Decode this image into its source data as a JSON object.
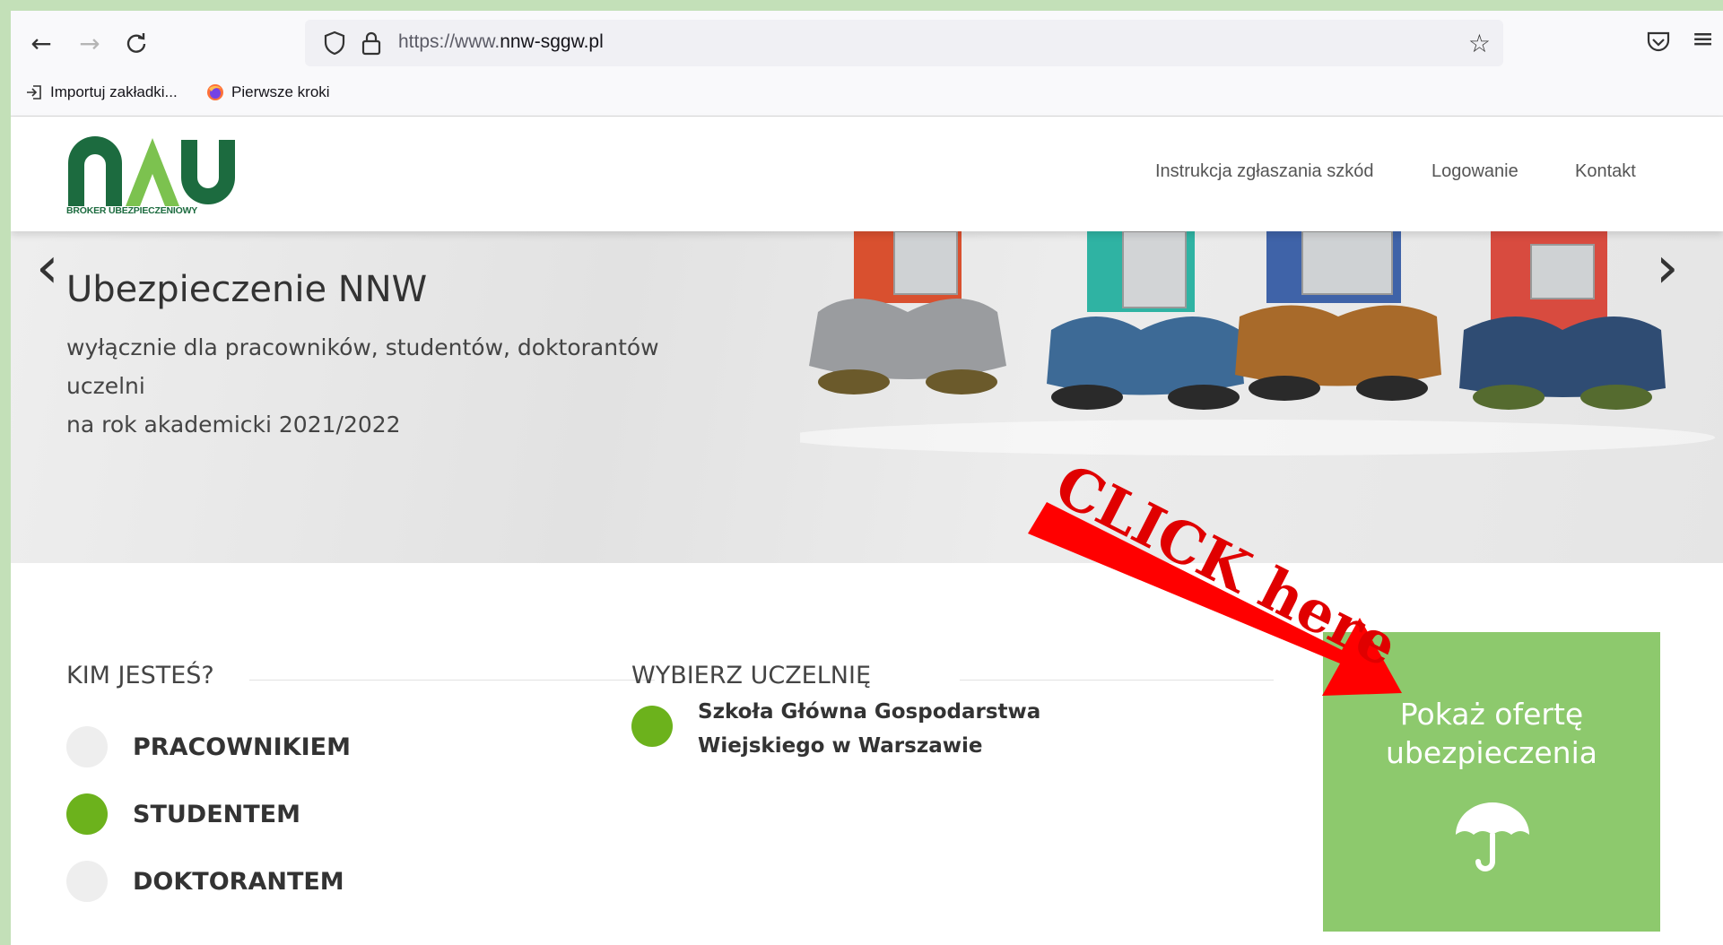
{
  "browser": {
    "url_prefix": "https://www.",
    "url_domain": "nnw-sggw.pl",
    "bookmarks": [
      {
        "label": "Importuj zakładki..."
      },
      {
        "label": "Pierwsze kroki"
      }
    ]
  },
  "header": {
    "logo_sub": "BROKER UBEZPIECZENIOWY",
    "menu": [
      {
        "label": "Instrukcja zgłaszania szkód"
      },
      {
        "label": "Logowanie"
      },
      {
        "label": "Kontakt"
      }
    ]
  },
  "hero": {
    "title": "Ubezpieczenie NNW",
    "subtitle_line1": "wyłącznie dla pracowników, studentów, doktorantów uczelni",
    "subtitle_line2": "na rok akademicki 2021/2022"
  },
  "annotation": {
    "text": "CLICK here",
    "color": "#ff0000"
  },
  "form": {
    "who_label": "KIM JESTEŚ?",
    "options": [
      {
        "label": "PRACOWNIKIEM",
        "selected": false
      },
      {
        "label": "STUDENTEM",
        "selected": true
      },
      {
        "label": "DOKTORANTEM",
        "selected": false
      }
    ],
    "university_label": "WYBIERZ UCZELNIĘ",
    "university": {
      "label": "Szkoła Główna Gospodarstwa Wiejskiego w Warszawie",
      "selected": true
    }
  },
  "offer": {
    "line1": "Pokaż ofertę",
    "line2": "ubezpieczenia",
    "icon": "umbrella-icon"
  },
  "colors": {
    "accent_green": "#6cb21c",
    "offer_green": "#8dc96d",
    "logo_green": "#1c6b3f",
    "logo_light": "#7cc24f"
  }
}
